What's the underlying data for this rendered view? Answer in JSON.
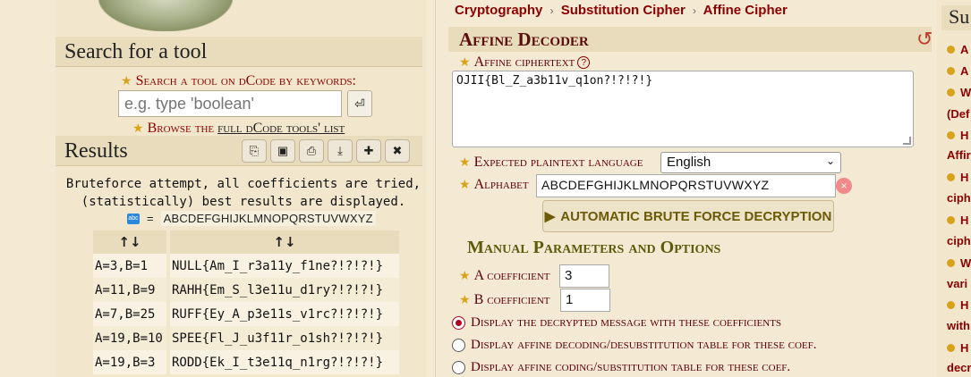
{
  "breadcrumb": [
    "Cryptography",
    "Substitution Cipher",
    "Affine Cipher"
  ],
  "left": {
    "search_section_title": "Search for a tool",
    "search_label": "Search a tool on dCode by keywords:",
    "search_placeholder": "e.g. type 'boolean'",
    "browse_prefix": "Browse the ",
    "browse_link": "full dCode tools' list"
  },
  "results": {
    "title": "Results",
    "toolbar_icons": [
      "copy-icon",
      "save-icon",
      "print-icon",
      "download-icon",
      "pin-icon",
      "close-icon"
    ],
    "message": "Bruteforce attempt, all coefficients are tried, (statistically) best results are displayed.",
    "alphabet_eq": "=",
    "alphabet": "ABCDEFGHIJKLMNOPQRSTUVWXYZ",
    "col_headers": [
      "↑↓",
      "↑↓"
    ],
    "rows": [
      [
        "A=3,B=1",
        "NULL{Am_I_r3a11y_f1ne?!?!?!}"
      ],
      [
        "A=11,B=9",
        "RAHH{Em_S_l3e11u_d1ry?!?!?!}"
      ],
      [
        "A=7,B=25",
        "RUFF{Ey_A_p3e11s_v1rc?!?!?!}"
      ],
      [
        "A=19,B=10",
        "SPEE{Fl_J_u3f11r_o1sh?!?!?!}"
      ],
      [
        "A=19,B=3",
        "RODD{Ek_I_t3e11q_n1rg?!?!?!}"
      ]
    ]
  },
  "decoder": {
    "title": "Affine Decoder",
    "ciphertext_label": "Affine ciphertext",
    "ciphertext_value": "OJII{Bl_Z_a3b11v_q1on?!?!?!}",
    "language_label": "Expected plaintext language",
    "language_value": "English",
    "alphabet_label": "Alphabet",
    "alphabet_value": "ABCDEFGHIJKLMNOPQRSTUVWXYZ",
    "brute_button": "AUTOMATIC BRUTE FORCE DECRYPTION",
    "manual_title": "Manual Parameters and Options",
    "a_label": "A coefficient",
    "a_value": "3",
    "b_label": "B coefficient",
    "b_value": "1",
    "options": [
      "Display the decrypted message with these coefficients",
      "Display affine decoding/desubstitution table for these coef.",
      "Display affine coding/substitution table for these coef."
    ],
    "selected_option": 0
  },
  "summary": {
    "title": "Su",
    "items": [
      "A",
      "A",
      "W",
      "H",
      "H",
      "H",
      "W",
      "H",
      "H"
    ],
    "continuations": [
      "(Def",
      "Affir",
      "ciph",
      "ciph",
      "vari",
      "with",
      "decr"
    ]
  },
  "colors": {
    "accent": "#8b0000",
    "background": "#f4ead4",
    "header_bg": "#e9dcbc",
    "star": "#d9a21b",
    "button_text": "#6b5a06"
  }
}
